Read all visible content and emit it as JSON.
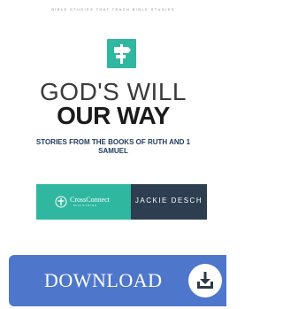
{
  "book": {
    "series": "BIBLE STUDIES THAT TEACH BIBLE STUDIES",
    "title_line1": "GOD'S WILL",
    "title_line2": "OUR WAY",
    "subtitle": "STORIES FROM THE BOOKS OF RUTH AND 1 SAMUEL",
    "publisher_name": "CrossConnect",
    "publisher_sub": "MINISTRIES",
    "author": "JACKIE DESCH",
    "logo_icon": "signpost-icon"
  },
  "download": {
    "label": "DOWNLOAD",
    "icon": "download-tray-icon"
  },
  "colors": {
    "teal": "#2fb7a0",
    "navy": "#2c3e50",
    "button_blue": "#4e77cc",
    "subtitle_blue": "#1e3a5c"
  }
}
